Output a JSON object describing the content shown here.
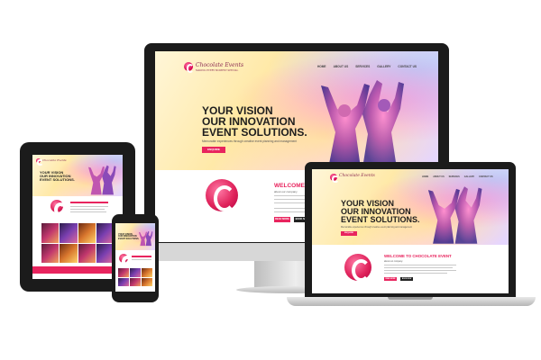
{
  "brand": {
    "logo_text": "Chocolate Events",
    "tagline": "MAKING EVERY MOMENT SPECIAL"
  },
  "nav": {
    "items": [
      "HOME",
      "ABOUT US",
      "SERVICES",
      "GALLERY",
      "CONTACT US"
    ]
  },
  "hero": {
    "line1": "YOUR VISION",
    "line2": "OUR INNOVATION",
    "line3": "EVENT SOLUTIONS.",
    "subtitle": "Memorable experiences through creative event planning and management",
    "button": "ENQUIRE"
  },
  "welcome": {
    "title_short": "WELCOME TO CHO",
    "title_full": "WELCOME TO CHOCOLATE EVENT",
    "subtitle": "about our company",
    "read_more": "READ MORE",
    "contact": "BOOK NOW"
  },
  "colors": {
    "accent": "#e8245e",
    "dark": "#222222",
    "device_black": "#1b1b1b"
  },
  "icons": {
    "logo": "chocolate-c-logo",
    "dancers": "dancing-silhouettes-image"
  }
}
